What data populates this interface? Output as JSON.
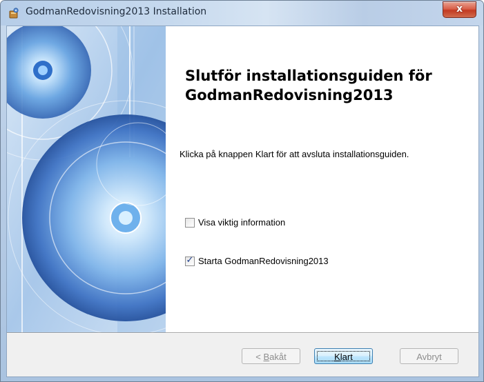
{
  "window": {
    "title": "GodmanRedovisning2013 Installation",
    "close_glyph": "x",
    "close_icon": "close-icon",
    "app_icon": "installer-icon"
  },
  "page": {
    "heading": "Slutför installationsguiden för GodmanRedovisning2013",
    "instruction": "Klicka på knappen Klart för att avsluta installationsguiden.",
    "side_graphic": "wizard-banner-graphic"
  },
  "options": [
    {
      "label": "Visa viktig information",
      "checked": false
    },
    {
      "label": "Starta GodmanRedovisning2013",
      "checked": true
    }
  ],
  "buttons": {
    "back": {
      "prefix": "< ",
      "accel": "B",
      "rest": "akåt",
      "enabled": false
    },
    "finish": {
      "accel": "K",
      "rest": "lart",
      "enabled": true
    },
    "cancel": {
      "label": "Avbryt",
      "enabled": false
    }
  },
  "colors": {
    "accent": "#3c7fb1",
    "close_button": "#c23a22",
    "checkmark": "#1f3e8c"
  }
}
